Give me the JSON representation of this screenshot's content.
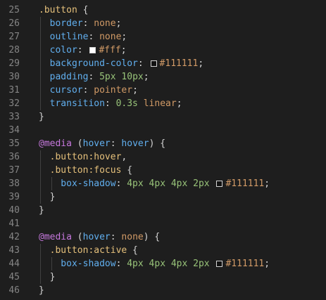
{
  "editor": {
    "lines": [
      {
        "n": "25",
        "tokens": [
          {
            "t": ".button",
            "c": "sel"
          },
          {
            "t": " {",
            "c": "punc"
          }
        ]
      },
      {
        "n": "26",
        "tokens": [
          {
            "t": "  border",
            "c": "prop"
          },
          {
            "t": ": ",
            "c": "punc"
          },
          {
            "t": "none",
            "c": "val"
          },
          {
            "t": ";",
            "c": "punc"
          }
        ]
      },
      {
        "n": "27",
        "tokens": [
          {
            "t": "  outline",
            "c": "prop"
          },
          {
            "t": ": ",
            "c": "punc"
          },
          {
            "t": "none",
            "c": "val"
          },
          {
            "t": ";",
            "c": "punc"
          }
        ]
      },
      {
        "n": "28",
        "tokens": [
          {
            "t": "  color",
            "c": "prop"
          },
          {
            "t": ": ",
            "c": "punc"
          },
          {
            "swatch": "#ffffff"
          },
          {
            "t": "#fff",
            "c": "val"
          },
          {
            "t": ";",
            "c": "punc"
          }
        ]
      },
      {
        "n": "29",
        "tokens": [
          {
            "t": "  background-color",
            "c": "prop"
          },
          {
            "t": ": ",
            "c": "punc"
          },
          {
            "swatch": "#111111"
          },
          {
            "t": "#111111",
            "c": "val"
          },
          {
            "t": ";",
            "c": "punc"
          }
        ]
      },
      {
        "n": "30",
        "tokens": [
          {
            "t": "  padding",
            "c": "prop"
          },
          {
            "t": ": ",
            "c": "punc"
          },
          {
            "t": "5px 10px",
            "c": "num"
          },
          {
            "t": ";",
            "c": "punc"
          }
        ]
      },
      {
        "n": "31",
        "tokens": [
          {
            "t": "  cursor",
            "c": "prop"
          },
          {
            "t": ": ",
            "c": "punc"
          },
          {
            "t": "pointer",
            "c": "val"
          },
          {
            "t": ";",
            "c": "punc"
          }
        ]
      },
      {
        "n": "32",
        "tokens": [
          {
            "t": "  transition",
            "c": "prop"
          },
          {
            "t": ": ",
            "c": "punc"
          },
          {
            "t": "0.3s",
            "c": "num"
          },
          {
            "t": " ",
            "c": "punc"
          },
          {
            "t": "linear",
            "c": "val"
          },
          {
            "t": ";",
            "c": "punc"
          }
        ]
      },
      {
        "n": "33",
        "tokens": [
          {
            "t": "}",
            "c": "punc"
          }
        ]
      },
      {
        "n": "34",
        "tokens": []
      },
      {
        "n": "35",
        "tokens": [
          {
            "t": "@media",
            "c": "at"
          },
          {
            "t": " (",
            "c": "punc"
          },
          {
            "t": "hover",
            "c": "media"
          },
          {
            "t": ": ",
            "c": "punc"
          },
          {
            "t": "hover",
            "c": "media"
          },
          {
            "t": ") {",
            "c": "punc"
          }
        ]
      },
      {
        "n": "36",
        "tokens": [
          {
            "t": "  .button:hover",
            "c": "sel"
          },
          {
            "t": ",",
            "c": "punc"
          }
        ]
      },
      {
        "n": "37",
        "tokens": [
          {
            "t": "  .button:focus",
            "c": "sel"
          },
          {
            "t": " {",
            "c": "punc"
          }
        ]
      },
      {
        "n": "38",
        "tokens": [
          {
            "t": "    box-shadow",
            "c": "prop"
          },
          {
            "t": ": ",
            "c": "punc"
          },
          {
            "t": "4px 4px 4px 2px",
            "c": "num"
          },
          {
            "t": " ",
            "c": "punc"
          },
          {
            "swatch": "#111111"
          },
          {
            "t": "#111111",
            "c": "val"
          },
          {
            "t": ";",
            "c": "punc"
          }
        ]
      },
      {
        "n": "39",
        "tokens": [
          {
            "t": "  }",
            "c": "punc"
          }
        ]
      },
      {
        "n": "40",
        "tokens": [
          {
            "t": "}",
            "c": "punc"
          }
        ]
      },
      {
        "n": "41",
        "tokens": []
      },
      {
        "n": "42",
        "tokens": [
          {
            "t": "@media",
            "c": "at"
          },
          {
            "t": " (",
            "c": "punc"
          },
          {
            "t": "hover",
            "c": "media"
          },
          {
            "t": ": ",
            "c": "punc"
          },
          {
            "t": "none",
            "c": "val"
          },
          {
            "t": ") {",
            "c": "punc"
          }
        ]
      },
      {
        "n": "43",
        "tokens": [
          {
            "t": "  .button:active",
            "c": "sel"
          },
          {
            "t": " {",
            "c": "punc"
          }
        ]
      },
      {
        "n": "44",
        "tokens": [
          {
            "t": "    box-shadow",
            "c": "prop"
          },
          {
            "t": ": ",
            "c": "punc"
          },
          {
            "t": "4px 4px 4px 2px",
            "c": "num"
          },
          {
            "t": " ",
            "c": "punc"
          },
          {
            "swatch": "#111111"
          },
          {
            "t": "#111111",
            "c": "val"
          },
          {
            "t": ";",
            "c": "punc"
          }
        ]
      },
      {
        "n": "45",
        "tokens": [
          {
            "t": "  }",
            "c": "punc"
          }
        ]
      },
      {
        "n": "46",
        "tokens": [
          {
            "t": "}",
            "c": "punc"
          }
        ]
      }
    ]
  },
  "colors": {
    "background": "#1e1e1e",
    "line_number": "#858585",
    "selector": "#e5c07b",
    "property": "#61afef",
    "value": "#d19a66",
    "number": "#98c379",
    "at_rule": "#c678dd"
  }
}
